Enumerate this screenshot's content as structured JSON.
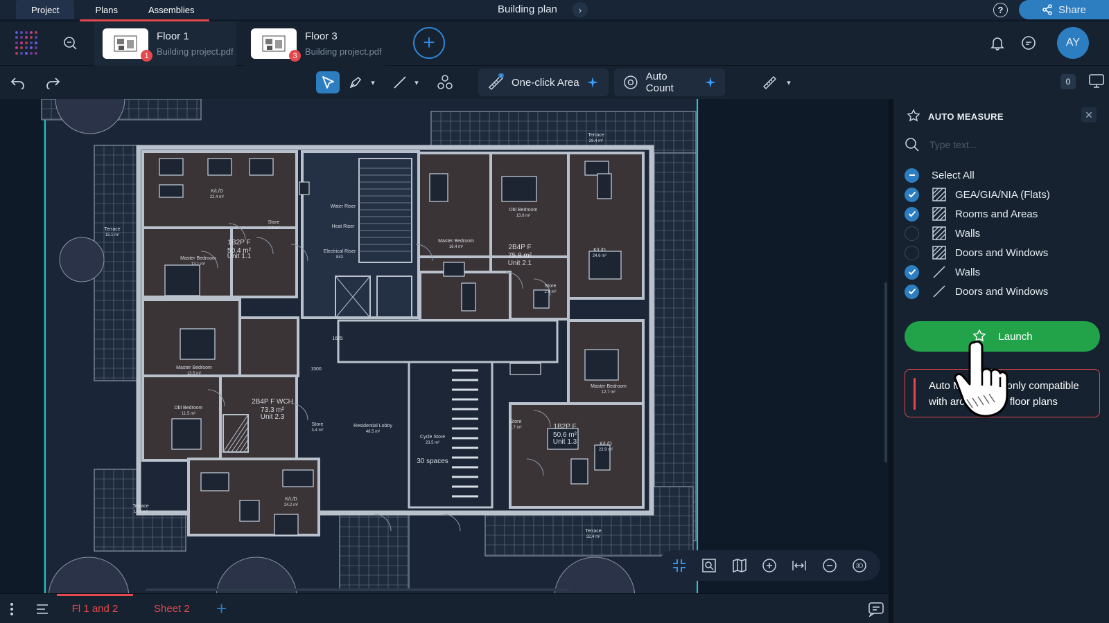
{
  "topbar": {
    "tabs": [
      "Project",
      "Plans",
      "Assemblies"
    ],
    "document_title": "Building plan",
    "share_label": "Share"
  },
  "files": [
    {
      "name": "Floor 1",
      "file": "Building project.pdf",
      "badge": "1"
    },
    {
      "name": "Floor 3",
      "file": "Building project.pdf",
      "badge": "3"
    }
  ],
  "user": {
    "initials": "AY"
  },
  "toolbar": {
    "one_click_area": "One-click Area",
    "auto_count": "Auto Count",
    "count": "0"
  },
  "plan": {
    "labels": [
      {
        "t": "K/L/D",
        "s": "22.4 m²"
      },
      {
        "t": "1B2P F",
        "s": "50.4 m²"
      },
      {
        "t": "Unit 1.1",
        "s": ""
      },
      {
        "t": "Master Bedroom",
        "s": "13.1 m²"
      },
      {
        "t": "Store",
        "s": "1.9 m²"
      },
      {
        "t": "Terrace",
        "s": "15.1 m²"
      },
      {
        "t": "Water Riser",
        "s": ""
      },
      {
        "t": "Heat Riser",
        "s": ""
      },
      {
        "t": "Electrical Riser",
        "s": "843"
      },
      {
        "t": "Master Bedroom",
        "s": "13.5 m²"
      },
      {
        "t": "2B4P F WCH",
        "s": "73.3 m²"
      },
      {
        "t": "Unit 2.3",
        "s": ""
      },
      {
        "t": "Dbl Bedroom",
        "s": "11.5 m²"
      },
      {
        "t": "Store",
        "s": "3.4 m²"
      },
      {
        "t": "Residential Lobby",
        "s": "48.5 m²"
      },
      {
        "t": "Cycle Store",
        "s": "23.5 m²"
      },
      {
        "t": "30 spaces",
        "s": ""
      },
      {
        "t": "Terrace",
        "s": "14.6 m²"
      },
      {
        "t": "K/L/D",
        "s": "24.2 m²"
      },
      {
        "t": "Dbl Bedroom",
        "s": "13.8 m²"
      },
      {
        "t": "Master Bedroom",
        "s": "16.4 m²"
      },
      {
        "t": "2B4P F",
        "s": "75.8 m²"
      },
      {
        "t": "Unit 2.1",
        "s": ""
      },
      {
        "t": "K/L/D",
        "s": "24.6 m²"
      },
      {
        "t": "Store",
        "s": "2.4 m²"
      },
      {
        "t": "Terrace",
        "s": "28.4 m²"
      },
      {
        "t": "Master Bedroom",
        "s": "12.7 m²"
      },
      {
        "t": "1B2P F",
        "s": "50.6 m²"
      },
      {
        "t": "Unit 1.3",
        "s": ""
      },
      {
        "t": "K/L/D",
        "s": "23.9 m²"
      },
      {
        "t": "Store",
        "s": "1.7 m²"
      },
      {
        "t": "Terrace",
        "s": "32.4 m²"
      },
      {
        "t": "1500",
        "s": ""
      },
      {
        "t": "1625",
        "s": ""
      }
    ]
  },
  "panel": {
    "title": "AUTO MEASURE",
    "search_placeholder": "Type text...",
    "select_all": "Select All",
    "items": [
      {
        "label": "GEA/GIA/NIA (Flats)",
        "checked": true,
        "icon": "area-hatch-icon"
      },
      {
        "label": "Rooms and Areas",
        "checked": true,
        "icon": "area-hatch-icon"
      },
      {
        "label": "Walls",
        "checked": false,
        "icon": "area-hatch-icon"
      },
      {
        "label": "Doors and Windows",
        "checked": false,
        "icon": "area-hatch-icon"
      },
      {
        "label": "Walls",
        "checked": true,
        "icon": "line-icon"
      },
      {
        "label": "Doors and Windows",
        "checked": true,
        "icon": "line-icon"
      }
    ],
    "launch_label": "Launch",
    "warning": "Auto Measure is only compatible with architectural floor plans"
  },
  "sheets": [
    "Fl 1 and 2",
    "Sheet 2"
  ],
  "colors": {
    "accent": "#2c7ec1",
    "launch": "#22a34a",
    "alert": "#e5484d",
    "room_fill": "#3b3436",
    "wall": "#b9c2cc"
  }
}
